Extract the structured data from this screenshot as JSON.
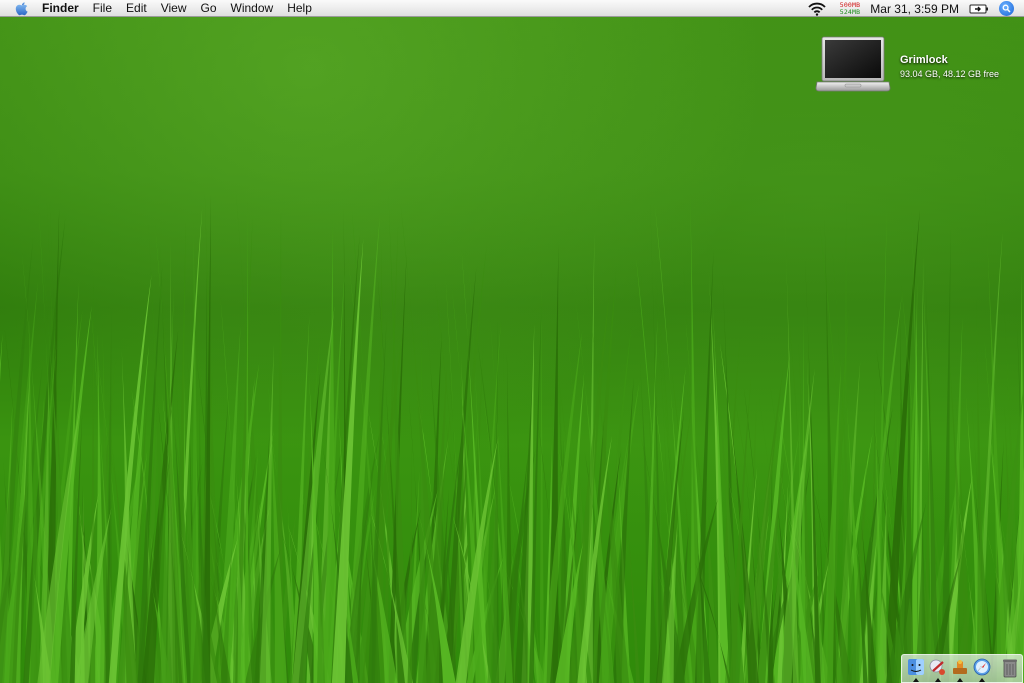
{
  "menubar": {
    "apple_icon": "apple-logo-icon",
    "app_name": "Finder",
    "menus": [
      "File",
      "Edit",
      "View",
      "Go",
      "Window",
      "Help"
    ],
    "wifi_icon": "wifi-icon",
    "memory": {
      "used": "500MB",
      "free": "524MB",
      "used_color": "#d01818",
      "free_color": "#1a8a1a"
    },
    "clock": "Mar 31, 3:59 PM",
    "battery_icon": "battery-charging-icon",
    "spotlight_icon": "spotlight-search-icon"
  },
  "desktop": {
    "wallpaper": "grass",
    "icons": [
      {
        "name": "Grimlock",
        "info": "93.04 GB, 48.12 GB free",
        "icon": "laptop-icon"
      }
    ]
  },
  "dock": {
    "items": [
      {
        "icon": "finder-icon",
        "running": true
      },
      {
        "icon": "scissors-app-icon",
        "running": true
      },
      {
        "icon": "terminal-stamp-icon",
        "running": true
      },
      {
        "icon": "safari-compass-icon",
        "running": true
      }
    ],
    "trash_icon": "trash-icon"
  }
}
